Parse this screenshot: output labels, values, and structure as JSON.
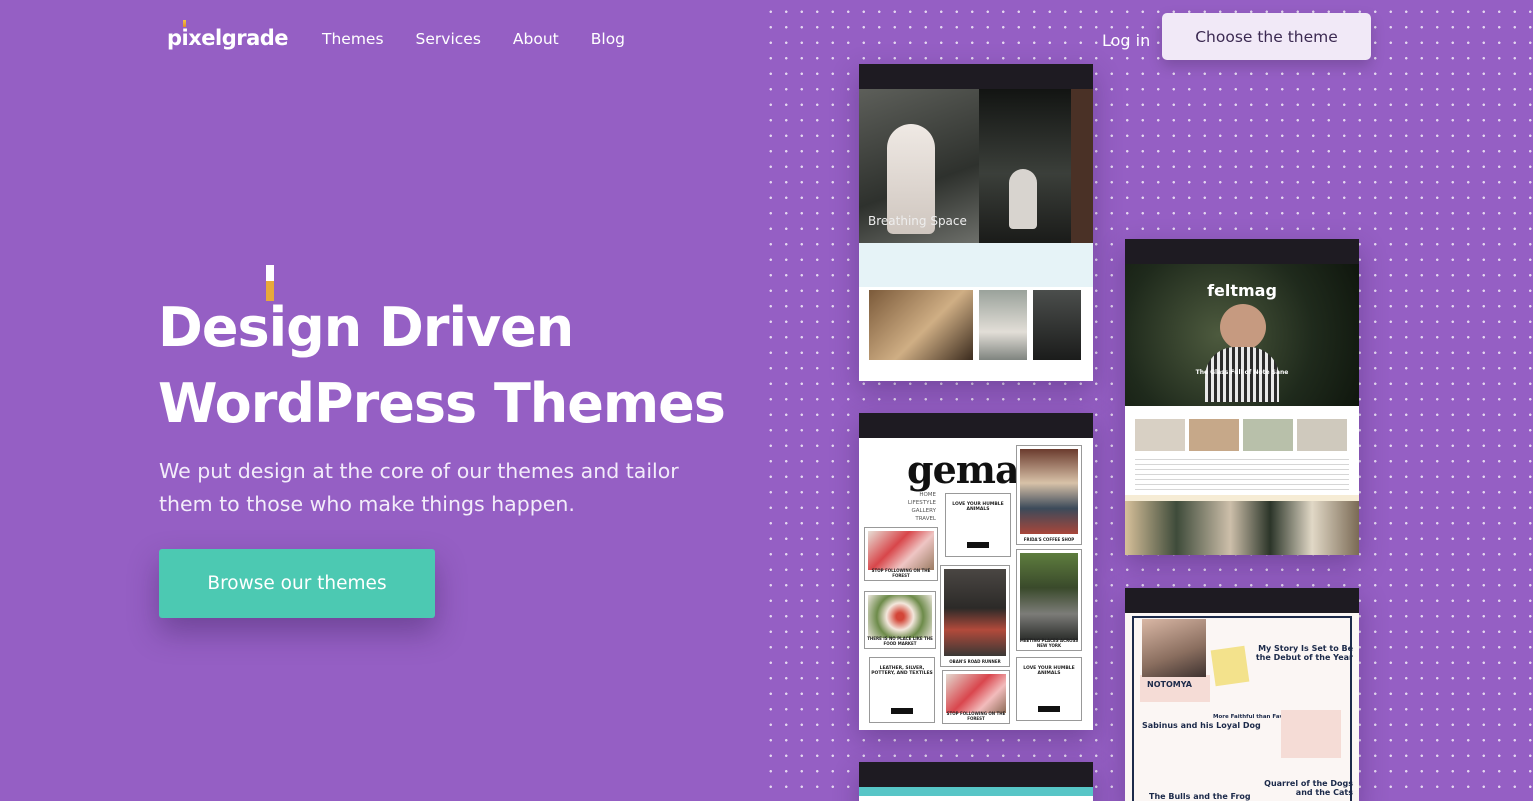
{
  "brand": {
    "logo_text": "pixelgrade"
  },
  "nav": {
    "items": [
      "Themes",
      "Services",
      "About",
      "Blog"
    ],
    "login": "Log in",
    "cta": "Choose the theme"
  },
  "hero": {
    "title_line1": "Design Driven",
    "title_line2": "WordPress Themes",
    "subtitle": "We put design at the core of our themes and tailor them to those who make things happen.",
    "cta": "Browse our themes"
  },
  "previews": {
    "breathing_space": {
      "title": "Breathing Space"
    },
    "feltmag": {
      "brand": "feltmag",
      "caption": "The Glass Full of Note Sane"
    },
    "gema": {
      "brand": "gema",
      "menu": [
        "HOME",
        "LIFESTYLE",
        "GALLERY",
        "TRAVEL"
      ],
      "tiles": [
        "STOP FOLLOWING ON THE FOREST",
        "FRIDA'S COFFEE SHOP",
        "THERE IS NO PLACE LIKE THE FOOD MARKET",
        "OBAN'S ROAD RUNNER",
        "MEETING PLACES ACROSS NEW YORK",
        "STOP FOLLOWING ON THE FOREST"
      ],
      "text_tiles": [
        "LOVE YOUR HUMBLE ANIMALS",
        "LEATHER, SILVER, POTTERY, AND TEXTILES",
        "LOVE YOUR HUMBLE ANIMALS"
      ]
    },
    "notomya": {
      "brand": "NOTOMYA",
      "headline1": "My Story Is Set to Be the Debut of the Year",
      "headline2": "Sabinus and his Loyal Dog",
      "headline3": "More Faithful than Favoured",
      "headline4": "Quarrel of the Dogs and the Cats",
      "headline5": "The Bulls and the Frog"
    }
  },
  "colors": {
    "background": "#955fc4",
    "cta_primary": "#4cc9b2",
    "cta_secondary": "#f1e9f7"
  }
}
